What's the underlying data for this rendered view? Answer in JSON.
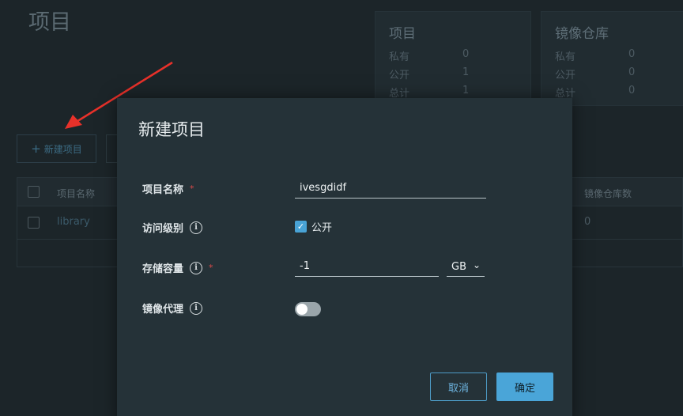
{
  "page": {
    "title": "项目"
  },
  "stats": {
    "projects": {
      "title": "项目",
      "rows": [
        {
          "label": "私有",
          "value": "0"
        },
        {
          "label": "公开",
          "value": "1"
        },
        {
          "label": "总计",
          "value": "1"
        }
      ]
    },
    "repos": {
      "title": "镜像仓库",
      "rows": [
        {
          "label": "私有",
          "value": "0"
        },
        {
          "label": "公开",
          "value": "0"
        },
        {
          "label": "总计",
          "value": "0"
        }
      ]
    }
  },
  "toolbar": {
    "new_project_label": "新建项目",
    "plus_glyph": "+"
  },
  "table": {
    "headers": {
      "name": "项目名称",
      "repo_count": "镜像仓库数"
    },
    "rows": [
      {
        "name": "library",
        "repo_count": "0"
      }
    ]
  },
  "modal": {
    "title": "新建项目",
    "name_label": "项目名称",
    "name_value": "ivesgdidf",
    "access_label": "访问级别",
    "public_label": "公开",
    "public_checked": true,
    "storage_label": "存储容量",
    "storage_value": "-1",
    "storage_unit": "GB",
    "proxy_label": "镜像代理",
    "proxy_enabled": false,
    "required_mark": "*",
    "info_glyph": "i",
    "check_glyph": "✓",
    "chevron_glyph": "⌄",
    "cancel_label": "取消",
    "ok_label": "确定"
  },
  "colors": {
    "accent": "#4aa5d8",
    "annotation_arrow": "#e8312a"
  }
}
